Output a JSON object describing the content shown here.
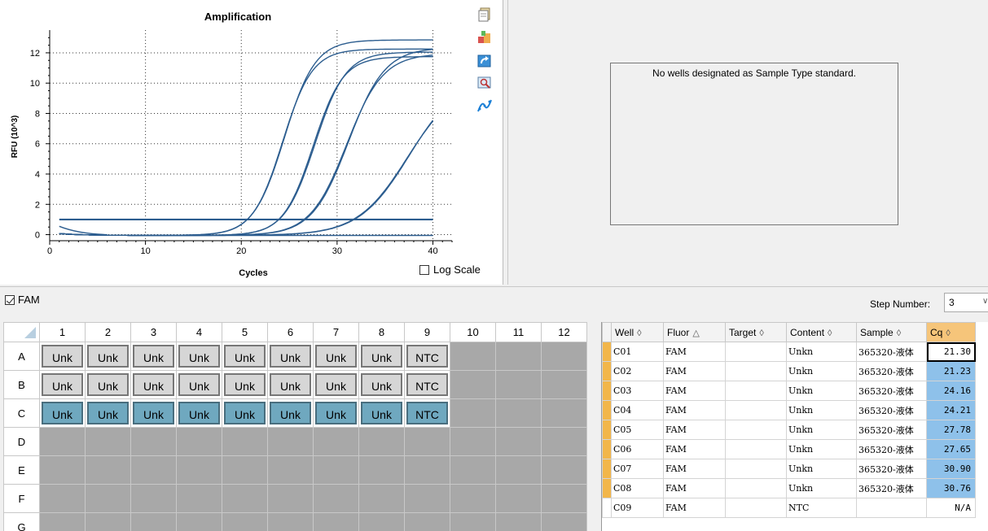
{
  "chart": {
    "title": "Amplification",
    "xlabel": "Cycles",
    "ylabel": "RFU (10^3)",
    "log_scale_label": "Log Scale",
    "log_scale_checked": false
  },
  "chart_data": {
    "type": "line",
    "title": "Amplification",
    "xlabel": "Cycles",
    "ylabel": "RFU (10^3)",
    "xlim": [
      0,
      42
    ],
    "ylim": [
      -0.4,
      13.5
    ],
    "xticks": [
      0,
      10,
      20,
      30,
      40
    ],
    "yticks": [
      0,
      2,
      4,
      6,
      8,
      10,
      12
    ],
    "grid": true,
    "threshold": 1.0,
    "series": [
      {
        "well": "C01",
        "midpoint": 24.5,
        "slope": 1.6,
        "plateau": 12.9
      },
      {
        "well": "C02",
        "midpoint": 24.3,
        "slope": 1.55,
        "plateau": 12.3
      },
      {
        "well": "C03",
        "midpoint": 27.7,
        "slope": 1.6,
        "plateau": 12.1
      },
      {
        "well": "C04",
        "midpoint": 27.5,
        "slope": 1.55,
        "plateau": 11.8
      },
      {
        "well": "C05",
        "midpoint": 31.2,
        "slope": 1.9,
        "plateau": 12.4
      },
      {
        "well": "C06",
        "midpoint": 31.0,
        "slope": 1.9,
        "plateau": 12.0
      },
      {
        "well": "C07",
        "midpoint": 37.5,
        "slope": 2.6,
        "plateau": 10.5
      },
      {
        "well": "C08",
        "midpoint": 37.3,
        "slope": 2.6,
        "plateau": 10.2
      },
      {
        "well": "C09",
        "midpoint": 99,
        "slope": 3,
        "plateau": 0.1
      }
    ],
    "color": "#2c5d8f"
  },
  "standard_curve": {
    "message": "No wells designated as Sample Type standard."
  },
  "fluor_filter": {
    "label": "FAM",
    "checked": true
  },
  "step": {
    "label": "Step Number:",
    "value": "3"
  },
  "plate": {
    "columns": [
      "1",
      "2",
      "3",
      "4",
      "5",
      "6",
      "7",
      "8",
      "9",
      "10",
      "11",
      "12"
    ],
    "rows": [
      {
        "label": "A",
        "wells": [
          "Unk",
          "Unk",
          "Unk",
          "Unk",
          "Unk",
          "Unk",
          "Unk",
          "Unk",
          "NTC",
          "",
          "",
          ""
        ],
        "style": "grey"
      },
      {
        "label": "B",
        "wells": [
          "Unk",
          "Unk",
          "Unk",
          "Unk",
          "Unk",
          "Unk",
          "Unk",
          "Unk",
          "NTC",
          "",
          "",
          ""
        ],
        "style": "grey"
      },
      {
        "label": "C",
        "wells": [
          "Unk",
          "Unk",
          "Unk",
          "Unk",
          "Unk",
          "Unk",
          "Unk",
          "Unk",
          "NTC",
          "",
          "",
          ""
        ],
        "style": "teal"
      },
      {
        "label": "D",
        "wells": [
          "",
          "",
          "",
          "",
          "",
          "",
          "",
          "",
          "",
          "",
          "",
          ""
        ],
        "style": "grey"
      },
      {
        "label": "E",
        "wells": [
          "",
          "",
          "",
          "",
          "",
          "",
          "",
          "",
          "",
          "",
          "",
          ""
        ],
        "style": "grey"
      },
      {
        "label": "F",
        "wells": [
          "",
          "",
          "",
          "",
          "",
          "",
          "",
          "",
          "",
          "",
          "",
          ""
        ],
        "style": "grey"
      },
      {
        "label": "G",
        "wells": [
          "",
          "",
          "",
          "",
          "",
          "",
          "",
          "",
          "",
          "",
          "",
          ""
        ],
        "style": "grey"
      }
    ]
  },
  "results": {
    "headers": [
      {
        "label": "Well",
        "sort": "◊"
      },
      {
        "label": "Fluor",
        "sort": "△"
      },
      {
        "label": "Target",
        "sort": "◊"
      },
      {
        "label": "Content",
        "sort": "◊"
      },
      {
        "label": "Sample",
        "sort": "◊"
      },
      {
        "label": "Cq",
        "sort": "◊"
      }
    ],
    "rows": [
      {
        "well": "C01",
        "fluor": "FAM",
        "target": "",
        "content": "Unkn",
        "sample": "365320-液体",
        "cq": "21.30"
      },
      {
        "well": "C02",
        "fluor": "FAM",
        "target": "",
        "content": "Unkn",
        "sample": "365320-液体",
        "cq": "21.23"
      },
      {
        "well": "C03",
        "fluor": "FAM",
        "target": "",
        "content": "Unkn",
        "sample": "365320-液体",
        "cq": "24.16"
      },
      {
        "well": "C04",
        "fluor": "FAM",
        "target": "",
        "content": "Unkn",
        "sample": "365320-液体",
        "cq": "24.21"
      },
      {
        "well": "C05",
        "fluor": "FAM",
        "target": "",
        "content": "Unkn",
        "sample": "365320-液体",
        "cq": "27.78"
      },
      {
        "well": "C06",
        "fluor": "FAM",
        "target": "",
        "content": "Unkn",
        "sample": "365320-液体",
        "cq": "27.65"
      },
      {
        "well": "C07",
        "fluor": "FAM",
        "target": "",
        "content": "Unkn",
        "sample": "365320-液体",
        "cq": "30.90"
      },
      {
        "well": "C08",
        "fluor": "FAM",
        "target": "",
        "content": "Unkn",
        "sample": "365320-液体",
        "cq": "30.76"
      },
      {
        "well": "C09",
        "fluor": "FAM",
        "target": "",
        "content": "NTC",
        "sample": "",
        "cq": "N/A"
      }
    ]
  },
  "toolbar_icons": [
    "copy-icon",
    "export-icon",
    "redo-icon",
    "zoom-icon",
    "curve-icon"
  ]
}
